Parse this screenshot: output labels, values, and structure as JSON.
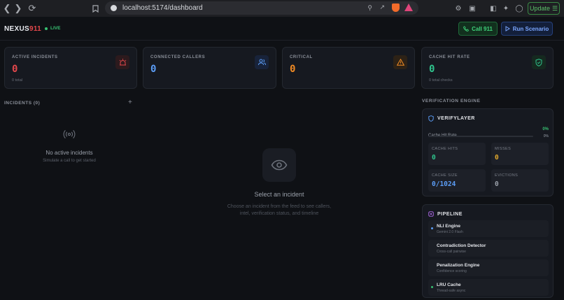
{
  "browser": {
    "url": "localhost:5174/dashboard",
    "update_label": "Update"
  },
  "header": {
    "logo_main": "NEXUS",
    "logo_accent": "911",
    "live_label": "LIVE",
    "call_label": "Call 911",
    "run_label": "Run Scenario"
  },
  "stats": [
    {
      "label": "ACTIVE INCIDENTS",
      "value": "0",
      "sub": "0 total",
      "color": "#e2474b",
      "icon": "siren-icon"
    },
    {
      "label": "CONNECTED CALLERS",
      "value": "0",
      "sub": "",
      "color": "#5b9cf5",
      "icon": "users-icon"
    },
    {
      "label": "CRITICAL",
      "value": "0",
      "sub": "",
      "color": "#f08a24",
      "icon": "alert-triangle-icon"
    },
    {
      "label": "CACHE HIT RATE",
      "value": "0",
      "sub": "0 total checks",
      "color": "#2fc48d",
      "icon": "shield-check-icon"
    }
  ],
  "incidents": {
    "title": "INCIDENTS (0)",
    "empty_title": "No active incidents",
    "empty_sub": "Simulate a call to get started"
  },
  "main": {
    "title": "Select an incident",
    "sub_line1": "Choose an incident from the feed to see callers,",
    "sub_line2": "intel, verification status, and timeline"
  },
  "verification": {
    "section_title": "VERIFICATION ENGINE",
    "panel_title": "VERIFYLAYER",
    "cache_hit_rate_label": "Cache Hit Rate",
    "cache_hit_rate_value": "0%",
    "bar_pct": "0%",
    "bar_fraction": 0,
    "cache_hits_label": "CACHE HITS",
    "cache_hits_value": "0",
    "misses_label": "MISSES",
    "misses_value": "0",
    "cache_size_label": "CACHE SIZE",
    "cache_size_value": "0/1024",
    "evictions_label": "EVICTIONS",
    "evictions_value": "0"
  },
  "pipeline": {
    "title": "PIPELINE",
    "stages": [
      {
        "name": "NLI Engine",
        "sub": "Gemini 2.0 Flash",
        "dot": "#5b9cf5"
      },
      {
        "name": "Contradiction Detector",
        "sub": "Cross-call pairwise",
        "dot": ""
      },
      {
        "name": "Penalization Engine",
        "sub": "Confidence scoring",
        "dot": ""
      },
      {
        "name": "LRU Cache",
        "sub": "Thread-safe async",
        "dot": "#38c172"
      }
    ]
  }
}
